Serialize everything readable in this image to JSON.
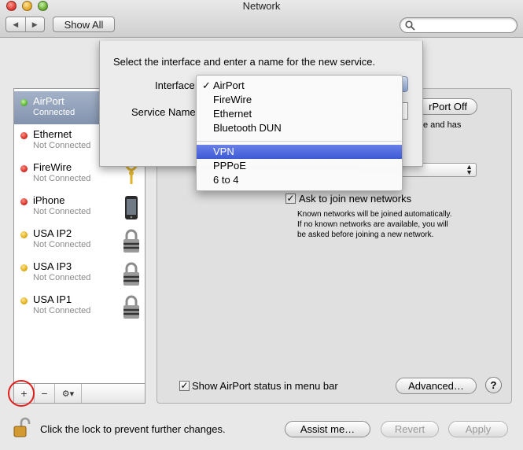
{
  "window": {
    "title": "Network"
  },
  "toolbar": {
    "back": "◀",
    "forward": "▶",
    "show_all": "Show All"
  },
  "sheet": {
    "instruction": "Select the interface and enter a name for the new service.",
    "interface_label": "Interface",
    "service_name_label": "Service Name"
  },
  "menu": {
    "checkmark": "✓",
    "items": [
      "AirPort",
      "FireWire",
      "Ethernet",
      "Bluetooth DUN",
      "VPN",
      "PPPoE",
      "6 to 4"
    ],
    "selected": "AirPort",
    "highlighted": "VPN"
  },
  "services": [
    {
      "name": "AirPort",
      "status": "Connected",
      "dot": "green",
      "icon": "wifi-icon"
    },
    {
      "name": "Ethernet",
      "status": "Not Connected",
      "dot": "red",
      "icon": "ethernet-icon"
    },
    {
      "name": "FireWire",
      "status": "Not Connected",
      "dot": "red",
      "icon": "firewire-icon"
    },
    {
      "name": "iPhone",
      "status": "Not Connected",
      "dot": "red",
      "icon": "iphone-icon"
    },
    {
      "name": "USA IP2",
      "status": "Not Connected",
      "dot": "yellow",
      "icon": "vpn-lock-icon"
    },
    {
      "name": "USA IP3",
      "status": "Not Connected",
      "dot": "yellow",
      "icon": "vpn-lock-icon"
    },
    {
      "name": "USA IP1",
      "status": "Not Connected",
      "dot": "yellow",
      "icon": "vpn-lock-icon"
    }
  ],
  "sidebar_buttons": {
    "add": "+",
    "remove": "−",
    "action": "⚙▾"
  },
  "detail": {
    "turn_off_partial": "rPort Off",
    "desc_partial": "e and has",
    "ask_join_label": "Ask to join new networks",
    "ask_join_checked": true,
    "ask_join_desc": [
      "Known networks will be joined automatically.",
      "If no known networks are available, you will",
      "be asked before joining a new network."
    ],
    "show_status_label": "Show AirPort status in menu bar",
    "show_status_checked": true,
    "advanced": "Advanced…",
    "help": "?"
  },
  "footer": {
    "lock_text": "Click the lock to prevent further changes.",
    "assist": "Assist me…",
    "revert": "Revert",
    "apply": "Apply"
  },
  "colors": {
    "selection": "#8393ae",
    "menu_highlight": "#3d5bd6",
    "annotation_circle": "#e0201c"
  }
}
